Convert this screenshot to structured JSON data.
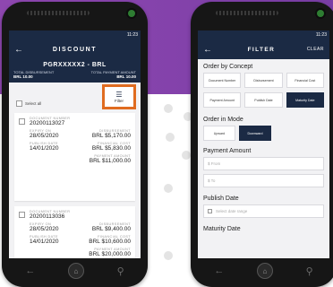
{
  "left_screen": {
    "status_time": "11:23",
    "header_title": "DISCOUNT",
    "account_number": "PGRXXXXX2 - BRL",
    "total_disbursement_label": "TOTAL DISBURSEMENT",
    "total_disbursement_value": "BRL 10.00",
    "total_payment_label": "TOTAL PAYMENT AMOUNT",
    "total_payment_value": "BRL 10.00",
    "select_all_label": "Select all",
    "filter_label": "Filter",
    "cards": [
      {
        "doc_label": "DOCUMENT NUMBER",
        "doc_value": "20200113027",
        "expiry_label": "EXPIRY ON",
        "expiry_value": "28/05/2020",
        "disb_label": "DISBURSEMENT",
        "disb_value": "BRL $5,170.00",
        "publish_label": "PUBLISH DATE",
        "publish_value": "14/01/2020",
        "fin_label": "FINANCIAL COST",
        "fin_value": "BRL $5,830.00",
        "pay_label": "PAYMENT AMOUNT",
        "pay_value": "BRL $11,000.00"
      },
      {
        "doc_label": "DOCUMENT NUMBER",
        "doc_value": "20200113036",
        "expiry_label": "EXPIRY ON",
        "expiry_value": "28/05/2020",
        "disb_label": "DISBURSEMENT",
        "disb_value": "BRL $9,400.00",
        "publish_label": "PUBLISH DATE",
        "publish_value": "14/01/2020",
        "fin_label": "FINANCIAL COST",
        "fin_value": "BRL $10,600.00",
        "pay_label": "PAYMENT AMOUNT",
        "pay_value": "BRL $20,000.00"
      }
    ]
  },
  "right_screen": {
    "status_time": "11:23",
    "header_title": "FILTER",
    "clear_label": "CLEAR",
    "order_concept_title": "Order by Concept",
    "concept_options": [
      "Document Number",
      "Disbursement",
      "Financial Cost",
      "Payment Amount",
      "Publish Date",
      "Maturity Date"
    ],
    "order_mode_title": "Order in Mode",
    "mode_options": [
      "Upward",
      "Downward"
    ],
    "payment_amount_title": "Payment Amount",
    "from_placeholder": "$  From",
    "to_placeholder": "$  To",
    "publish_date_title": "Publish Date",
    "date_placeholder": "Select date range",
    "maturity_title": "Maturity Date"
  },
  "colors": {
    "brand_navy": "#1b2a44",
    "highlight": "#e06c20",
    "bg_purple": "#8e47b0"
  }
}
